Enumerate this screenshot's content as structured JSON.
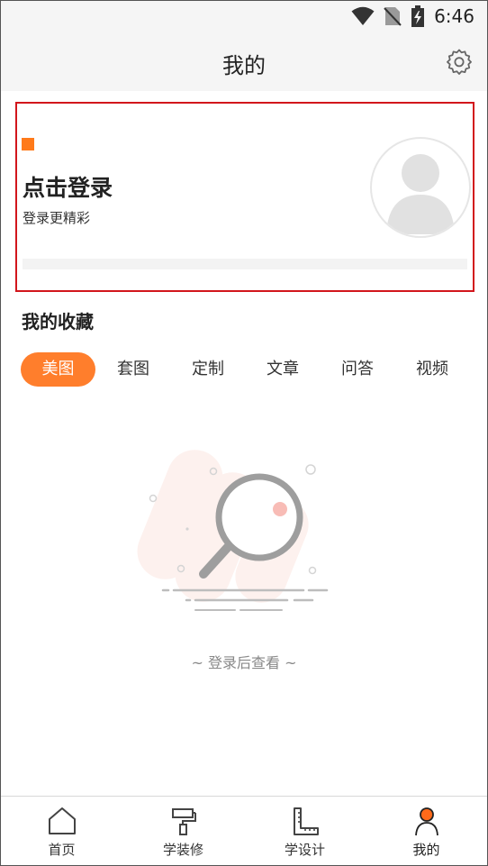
{
  "status_bar": {
    "time": "6:46",
    "icons": [
      "wifi-icon",
      "no-sim-icon",
      "battery-charging-icon"
    ]
  },
  "header": {
    "title": "我的",
    "settings_icon": "gear-icon"
  },
  "profile": {
    "login_title": "点击登录",
    "login_subtitle": "登录更精彩",
    "avatar_icon": "default-avatar-icon"
  },
  "favorites": {
    "title": "我的收藏",
    "tabs": [
      {
        "label": "美图",
        "active": true
      },
      {
        "label": "套图",
        "active": false
      },
      {
        "label": "定制",
        "active": false
      },
      {
        "label": "文章",
        "active": false
      },
      {
        "label": "问答",
        "active": false
      },
      {
        "label": "视频",
        "active": false
      }
    ],
    "empty_text": "~ 登录后查看 ~",
    "empty_icon": "magnifier-empty-icon"
  },
  "bottom_nav": {
    "items": [
      {
        "label": "首页",
        "icon": "home-icon",
        "active": false
      },
      {
        "label": "学装修",
        "icon": "paint-roller-icon",
        "active": false
      },
      {
        "label": "学设计",
        "icon": "ruler-icon",
        "active": false
      },
      {
        "label": "我的",
        "icon": "user-icon",
        "active": true
      }
    ]
  },
  "colors": {
    "accent": "#ff7e2c",
    "highlight_border": "#d2161c",
    "header_bg": "#f5f5f5"
  }
}
